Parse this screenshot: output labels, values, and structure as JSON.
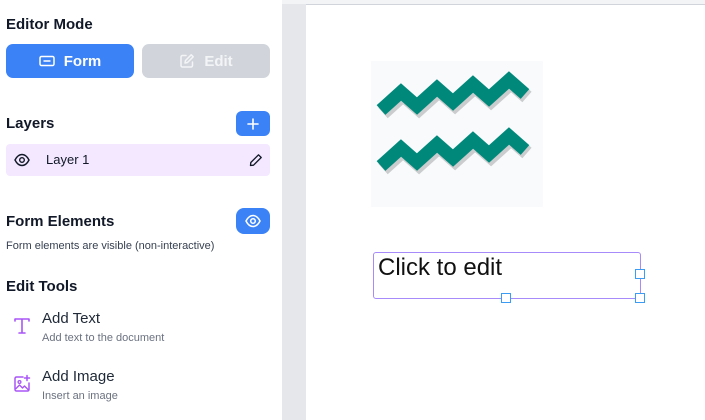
{
  "editor_mode": {
    "title": "Editor Mode",
    "form_label": "Form",
    "edit_label": "Edit"
  },
  "layers": {
    "title": "Layers",
    "items": [
      {
        "label": "Layer 1"
      }
    ]
  },
  "form_elements": {
    "title": "Form Elements",
    "hint": "Form elements are visible (non-interactive)"
  },
  "edit_tools": {
    "title": "Edit Tools",
    "tools": [
      {
        "title": "Add Text",
        "description": "Add text to the document",
        "icon": "text-type-icon"
      },
      {
        "title": "Add Image",
        "description": "Insert an image",
        "icon": "image-plus-icon"
      }
    ]
  },
  "canvas": {
    "text_box_content": "Click to edit",
    "image_icon": "aquarius-zodiac-icon"
  },
  "colors": {
    "accent": "#3b82f6",
    "layer_selected": "#f3e8ff",
    "tool_icon": "#a855f7",
    "zodiac_teal": "#00897b",
    "selection_border": "#a78bfa",
    "handle": "#3b9cf6"
  }
}
